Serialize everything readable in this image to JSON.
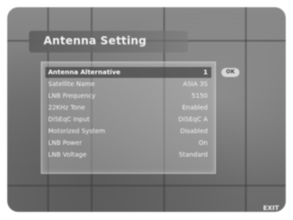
{
  "menu": {
    "title": "Antenna Setting",
    "rows": [
      {
        "label": "Antenna Alternative",
        "value": "1",
        "selected": true
      },
      {
        "label": "Satellite Name",
        "value": "ASIA 3S",
        "selected": false
      },
      {
        "label": "LNB Frequency",
        "value": "5150",
        "selected": false
      },
      {
        "label": "22KHz Tone",
        "value": "Enabled",
        "selected": false
      },
      {
        "label": "DiSEqC Input",
        "value": "DiSEqC A",
        "selected": false
      },
      {
        "label": "Motorized System",
        "value": "Disabled",
        "selected": false
      },
      {
        "label": "LNB Power",
        "value": "On",
        "selected": false
      },
      {
        "label": "LNB Voltage",
        "value": "Standard",
        "selected": false
      }
    ]
  },
  "keys": {
    "ok_label": "OK",
    "exit_label": "EXIT"
  }
}
